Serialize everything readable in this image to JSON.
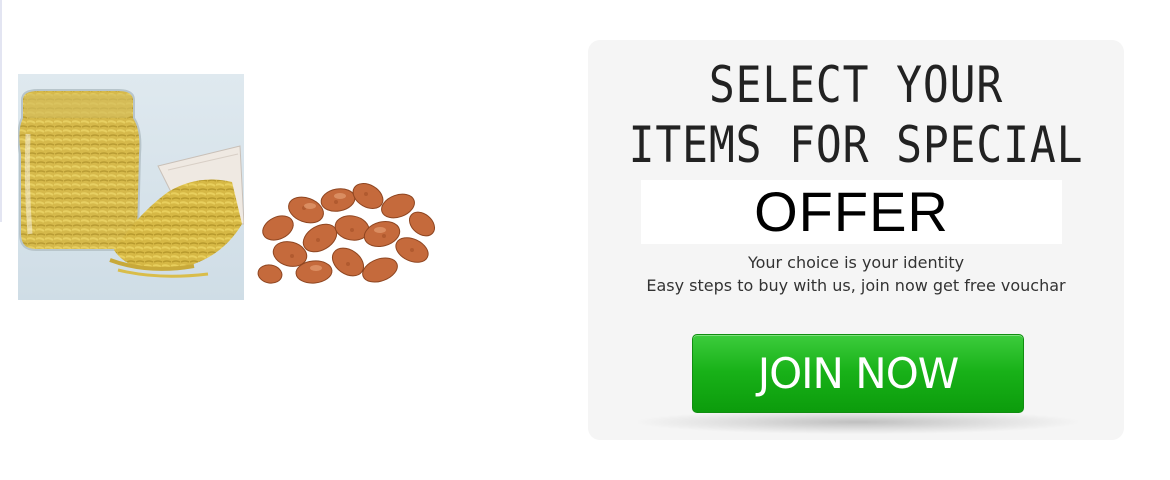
{
  "images": {
    "jar": "namkeen-jar-photo",
    "nuts": "masala-peanuts-photo"
  },
  "offer": {
    "headline_line1": "SELECT YOUR",
    "headline_line2": "ITEMS FOR SPECIAL",
    "highlight": "OFFER",
    "tagline": "Your choice is your identity",
    "subline": "Easy steps to buy with us, join now get free vouchar",
    "button_label": "JOIN NOW"
  },
  "colors": {
    "card_background": "#f5f5f5",
    "button_green": "#18b118",
    "button_text": "#ffffff"
  }
}
